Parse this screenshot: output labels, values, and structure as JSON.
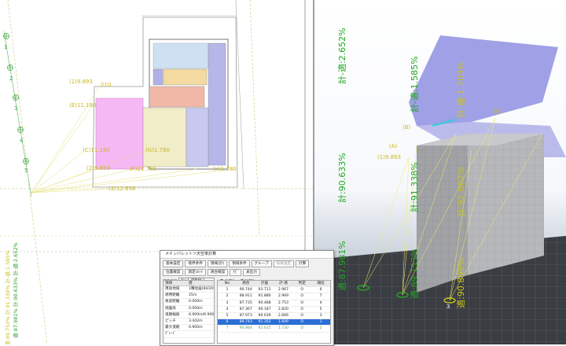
{
  "plan": {
    "axis_labels": [
      "1",
      "2",
      "3",
      "4",
      "5"
    ],
    "point_labels": [
      "(1)9.893",
      "(E)11.180",
      "(C)11.180",
      "(2)9.893",
      "(F)11.780",
      "(3)12.698",
      "(G)1.780",
      "(H)1.780"
    ],
    "partial_labels": [
      "210",
      "(A)11.180"
    ],
    "vertical_readout": "適:87.981% 計:90.633% 計-適:2.652%",
    "vertical_readout2": "適:89.753% 計:91.338% 計-適:1.585%"
  },
  "view3d": {
    "labels": [
      {
        "text": "計-適:2.652%",
        "color": "#1fa81f"
      },
      {
        "text": "計:90.633%",
        "color": "#1fa81f"
      },
      {
        "text": "適:87.981%",
        "color": "#1fa81f"
      },
      {
        "text": "計-適:1.585%",
        "color": "#1fa81f"
      },
      {
        "text": "計:91.338%",
        "color": "#1fa81f"
      },
      {
        "text": "適:89.753%",
        "color": "#1fa81f"
      },
      {
        "text": "計-適:1.703%",
        "color": "#c9c41e"
      },
      {
        "text": "計:92.602%",
        "color": "#c9c41e"
      },
      {
        "text": "適:90.899%",
        "color": "#c9c41e"
      }
    ],
    "point_labels": [
      "(A)",
      "(B)",
      "(1)9.893",
      "(C)"
    ],
    "ground_number": "3"
  },
  "dialog": {
    "title": "メインパレット＞天空率計算",
    "buttons": [
      "基本設定",
      "境界条件",
      "領域(計)",
      "領域条件",
      "グループ",
      "技術設定",
      "計算"
    ],
    "buttons2": [
      "位置確認",
      "測定ｺﾒﾝﾄ",
      "適合確認",
      "ﾅﾋﾞ",
      "表出力"
    ],
    "select_label": "道路斜線",
    "select_value": "No:1 道路線:1",
    "radio1": "計算1",
    "radio2": "計算2",
    "props_header": [
      "項目",
      "値"
    ],
    "props": [
      [
        "用途地域",
        "1種住居(60/200)"
      ],
      [
        "適用距離",
        "25m"
      ],
      [
        "後退距離",
        "0.000m"
      ],
      [
        "地盤高",
        "0.000m"
      ],
      [
        "道路幅員",
        "6.900m/6.900m"
      ],
      [
        "ピッチ",
        "3.442m"
      ],
      [
        "最大道路",
        "6.900m"
      ],
      [
        "ｸﾞﾚｰﾄﾞ",
        ""
      ]
    ],
    "table_headers": [
      "No",
      "適合",
      "計画",
      "計-適",
      "判定",
      "順位"
    ],
    "rows": [
      [
        "1",
        "90.744",
        "93.711",
        "2.967",
        "O",
        "6"
      ],
      [
        "2",
        "88.911",
        "91.880",
        "2.969",
        "O",
        "7"
      ],
      [
        "3",
        "87.735",
        "90.488",
        "2.753",
        "O",
        "4"
      ],
      [
        "4",
        "87.367",
        "90.187",
        "2.820",
        "O",
        "5"
      ],
      [
        "5",
        "87.973",
        "90.639",
        "2.666",
        "O",
        "3"
      ],
      [
        "6",
        "89.743",
        "91.352",
        "1.609",
        "O",
        "1"
      ],
      [
        "7",
        "90.884",
        "92.615",
        "1.730",
        "O",
        "2"
      ]
    ],
    "selected_row": 5
  }
}
